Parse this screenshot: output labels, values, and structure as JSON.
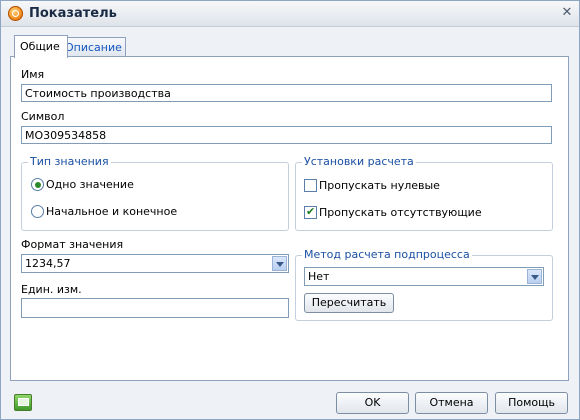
{
  "window": {
    "title": "Показатель"
  },
  "tabs": [
    {
      "label": "Общие"
    },
    {
      "label": "Описание"
    }
  ],
  "fields": {
    "name_label": "Имя",
    "name_value": "Стоимость производства",
    "symbol_label": "Символ",
    "symbol_value": "MO309534858"
  },
  "value_type": {
    "legend": "Тип значения",
    "options": [
      {
        "label": "Одно значение",
        "selected": true
      },
      {
        "label": "Начальное и конечное",
        "selected": false
      }
    ]
  },
  "calc_settings": {
    "legend": "Установки расчета",
    "options": [
      {
        "label": "Пропускать нулевые",
        "checked": false
      },
      {
        "label": "Пропускать отсутствующие",
        "checked": true
      }
    ]
  },
  "format": {
    "label": "Формат значения",
    "value": "1234,57"
  },
  "unit": {
    "label": "Един. изм.",
    "value": ""
  },
  "subprocess": {
    "legend": "Метод расчета подпроцесса",
    "value": "Нет",
    "recalc_label": "Пересчитать"
  },
  "footer": {
    "ok_label": "OK",
    "cancel_label": "Отмена",
    "help_label": "Помощь"
  },
  "colors": {
    "accent": "#1a4fa3",
    "tab_link": "#1557c0",
    "border": "#7f9db9"
  }
}
